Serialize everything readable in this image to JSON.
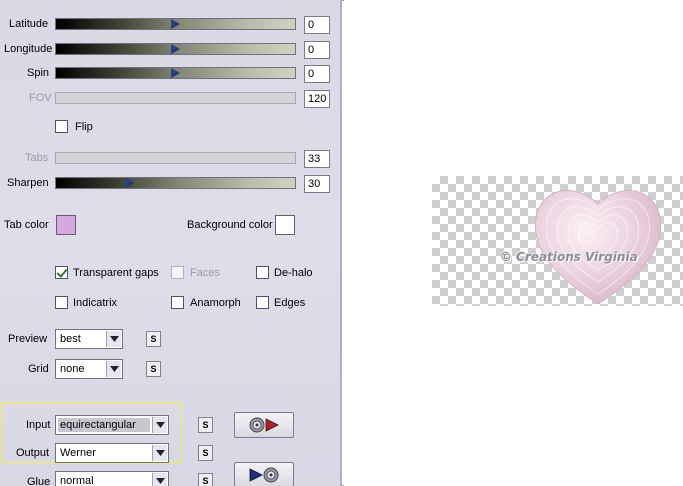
{
  "sliders": [
    {
      "key": "latitude",
      "label": "Latitude",
      "value": "0",
      "position": 0.5,
      "disabled": false
    },
    {
      "key": "longitude",
      "label": "Longitude",
      "value": "0",
      "position": 0.5,
      "disabled": false
    },
    {
      "key": "spin",
      "label": "Spin",
      "value": "0",
      "position": 0.5,
      "disabled": false
    },
    {
      "key": "fov",
      "label": "FOV",
      "value": "120",
      "position": 0,
      "disabled": true
    },
    {
      "key": "tabs",
      "label": "Tabs",
      "value": "33",
      "position": 0,
      "disabled": true
    },
    {
      "key": "sharpen",
      "label": "Sharpen",
      "value": "30",
      "position": 0.31,
      "disabled": false
    }
  ],
  "flip": {
    "label": "Flip",
    "checked": false
  },
  "tab_color": {
    "label": "Tab color",
    "color": "#d8a8dc"
  },
  "background_color": {
    "label": "Background color",
    "color": "#ffffff"
  },
  "options": {
    "transparent_gaps": {
      "label": "Transparent gaps",
      "checked": true
    },
    "faces": {
      "label": "Faces",
      "checked": false,
      "disabled": true
    },
    "de_halo": {
      "label": "De-halo",
      "checked": false
    },
    "indicatrix": {
      "label": "Indicatrix",
      "checked": false
    },
    "anamorph": {
      "label": "Anamorph",
      "checked": false
    },
    "edges": {
      "label": "Edges",
      "checked": false
    }
  },
  "preview": {
    "label": "Preview",
    "value": "best"
  },
  "grid": {
    "label": "Grid",
    "value": "none"
  },
  "input": {
    "label": "Input",
    "value": "equirectangular"
  },
  "output": {
    "label": "Output",
    "value": "Werner"
  },
  "glue": {
    "label": "Glue",
    "value": "normal"
  },
  "swap_label": "S",
  "watermark": "© Creations Virginia",
  "colors": {
    "panel_bg": "#dcdce8",
    "slider_thumb": "#1f3a85",
    "highlight_border": "#e8e88a"
  }
}
